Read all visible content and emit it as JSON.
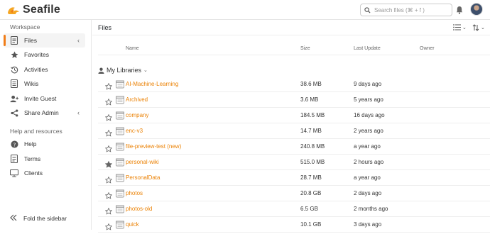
{
  "app": {
    "name": "Seafile",
    "brand_color": "#f07d18"
  },
  "search": {
    "placeholder": "Search files (⌘ + f )"
  },
  "sidebar": {
    "workspace_title": "Workspace",
    "items": [
      {
        "label": "Files",
        "icon": "files-icon",
        "active": true
      },
      {
        "label": "Favorites",
        "icon": "star-icon"
      },
      {
        "label": "Activities",
        "icon": "history-icon"
      },
      {
        "label": "Wikis",
        "icon": "wiki-icon"
      },
      {
        "label": "Invite Guest",
        "icon": "invite-guest-icon"
      },
      {
        "label": "Share Admin",
        "icon": "share-admin-icon"
      }
    ],
    "help_title": "Help and resources",
    "help_items": [
      {
        "label": "Help",
        "icon": "help-icon"
      },
      {
        "label": "Terms",
        "icon": "terms-icon"
      },
      {
        "label": "Clients",
        "icon": "clients-icon"
      }
    ],
    "fold_label": "Fold the sidebar"
  },
  "main": {
    "title": "Files",
    "columns": {
      "name": "Name",
      "size": "Size",
      "last_update": "Last Update",
      "owner": "Owner"
    },
    "group_label": "My Libraries",
    "libraries": [
      {
        "name": "AI-Machine-Learning",
        "size": "38.6 MB",
        "updated": "9 days ago",
        "starred": false
      },
      {
        "name": "Archived",
        "size": "3.6 MB",
        "updated": "5 years ago",
        "starred": false
      },
      {
        "name": "company",
        "size": "184.5 MB",
        "updated": "16 days ago",
        "starred": false
      },
      {
        "name": "enc-v3",
        "size": "14.7 MB",
        "updated": "2 years ago",
        "starred": false
      },
      {
        "name": "file-preview-test (new)",
        "size": "240.8 MB",
        "updated": "a year ago",
        "starred": false
      },
      {
        "name": "personal-wiki",
        "size": "515.0 MB",
        "updated": "2 hours ago",
        "starred": true
      },
      {
        "name": "PersonalData",
        "size": "28.7 MB",
        "updated": "a year ago",
        "starred": false
      },
      {
        "name": "photos",
        "size": "20.8 GB",
        "updated": "2 days ago",
        "starred": false
      },
      {
        "name": "photos-old",
        "size": "6.5 GB",
        "updated": "2 months ago",
        "starred": false
      },
      {
        "name": "quick",
        "size": "10.1 GB",
        "updated": "3 days ago",
        "starred": false
      }
    ]
  }
}
